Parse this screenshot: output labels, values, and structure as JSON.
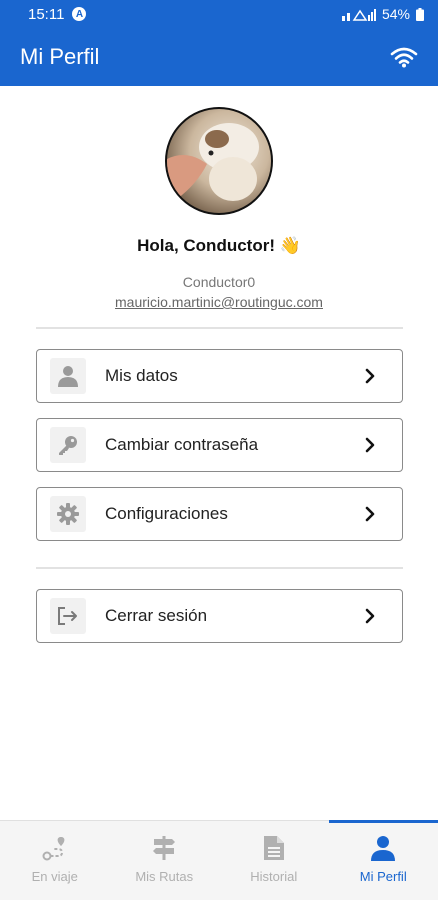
{
  "status_bar": {
    "time": "15:11",
    "nav_badge": "A",
    "battery": "54%"
  },
  "app_bar": {
    "title": "Mi Perfil",
    "wifi_icon": "wifi-icon"
  },
  "profile": {
    "greeting": "Hola, Conductor! 👋",
    "username": "Conductor0",
    "email": "mauricio.martinic@routinguc.com"
  },
  "menu": [
    {
      "icon": "person-icon",
      "label": "Mis datos"
    },
    {
      "icon": "key-icon",
      "label": "Cambiar contraseña"
    },
    {
      "icon": "gear-icon",
      "label": "Configuraciones"
    },
    {
      "icon": "logout-icon",
      "label": "Cerrar sesión"
    }
  ],
  "bottom_nav": {
    "active": "Mi Perfil",
    "accent_color": "#1a66cf",
    "tabs": [
      {
        "icon": "route-icon",
        "label": "En viaje"
      },
      {
        "icon": "signpost-icon",
        "label": "Mis Rutas"
      },
      {
        "icon": "document-icon",
        "label": "Historial"
      },
      {
        "icon": "person-icon",
        "label": "Mi Perfil"
      }
    ]
  }
}
